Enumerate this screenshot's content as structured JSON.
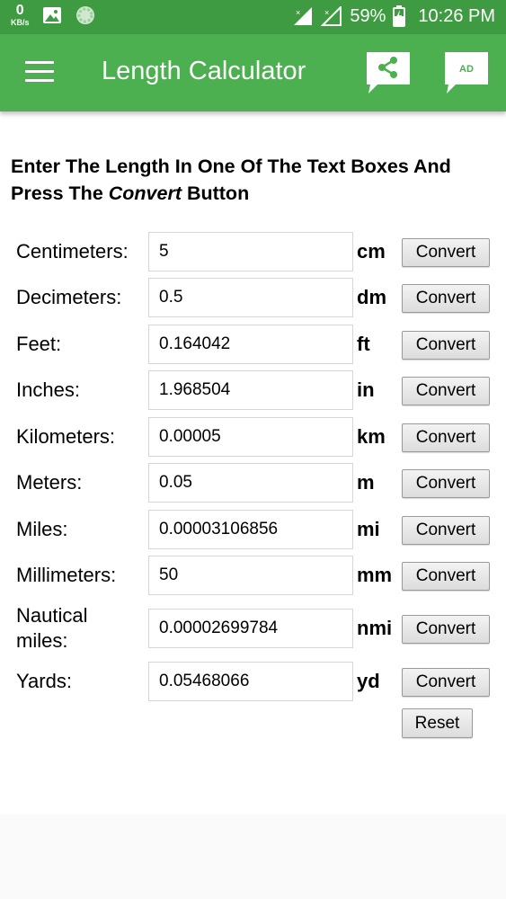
{
  "status_bar": {
    "net_speed_value": "0",
    "net_speed_unit": "KB/s",
    "battery_percent": "59%",
    "time": "10:26 PM",
    "color": "#3f9b41"
  },
  "app_bar": {
    "title": "Length Calculator",
    "ad_label": "AD",
    "color": "#4caf50"
  },
  "instructions": {
    "prefix": "Enter The Length In One Of The Text Boxes And Press The ",
    "emphasis": "Convert",
    "suffix": " Button"
  },
  "units": [
    {
      "label": "Centimeters:",
      "value": "5",
      "unit": "cm",
      "button": "Convert"
    },
    {
      "label": "Decimeters:",
      "value": "0.5",
      "unit": "dm",
      "button": "Convert"
    },
    {
      "label": "Feet:",
      "value": "0.164042",
      "unit": "ft",
      "button": "Convert"
    },
    {
      "label": "Inches:",
      "value": "1.968504",
      "unit": "in",
      "button": "Convert"
    },
    {
      "label": "Kilometers:",
      "value": "0.00005",
      "unit": "km",
      "button": "Convert"
    },
    {
      "label": "Meters:",
      "value": "0.05",
      "unit": "m",
      "button": "Convert"
    },
    {
      "label": "Miles:",
      "value": "0.00003106856",
      "unit": "mi",
      "button": "Convert"
    },
    {
      "label": "Millimeters:",
      "value": "50",
      "unit": "mm",
      "button": "Convert"
    },
    {
      "label": "Nautical miles:",
      "value": "0.00002699784",
      "unit": "nmi",
      "button": "Convert"
    },
    {
      "label": "Yards:",
      "value": "0.05468066",
      "unit": "yd",
      "button": "Convert"
    }
  ],
  "reset_label": "Reset"
}
